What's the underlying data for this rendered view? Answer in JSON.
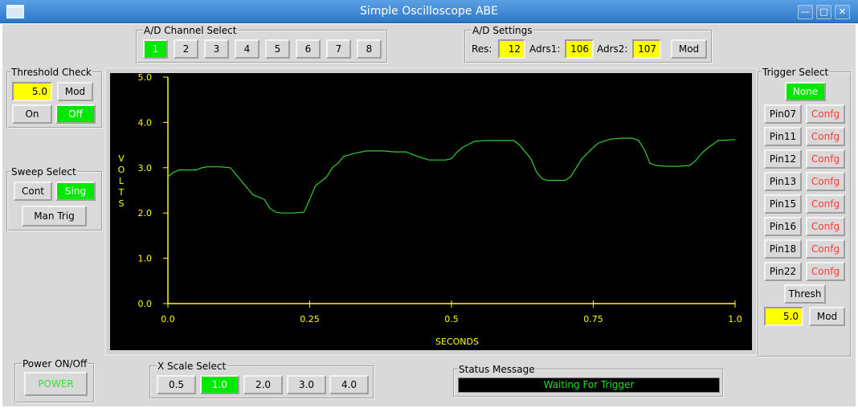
{
  "window": {
    "title": "Simple Oscilloscope ABE"
  },
  "channel_select": {
    "legend": "A/D Channel Select",
    "buttons": [
      "1",
      "2",
      "3",
      "4",
      "5",
      "6",
      "7",
      "8"
    ],
    "active": "1"
  },
  "ad_settings": {
    "legend": "A/D Settings",
    "res_label": "Res:",
    "res_value": "12",
    "adrs1_label": "Adrs1:",
    "adrs1_value": "106",
    "adrs2_label": "Adrs2:",
    "adrs2_value": "107",
    "mod_label": "Mod"
  },
  "threshold_check": {
    "legend": "Threshold Check",
    "value": "5.0",
    "mod_label": "Mod",
    "on_label": "On",
    "off_label": "Off",
    "active": "Off"
  },
  "sweep_select": {
    "legend": "Sweep Select",
    "cont_label": "Cont",
    "sing_label": "Sing",
    "active": "Sing",
    "man_trig_label": "Man Trig"
  },
  "trigger_select": {
    "legend": "Trigger Select",
    "none_label": "None",
    "pins": [
      "Pin07",
      "Pin11",
      "Pin12",
      "Pin13",
      "Pin15",
      "Pin16",
      "Pin18",
      "Pin22"
    ],
    "config_label": "Confg",
    "thresh_label": "Thresh",
    "value": "5.0",
    "mod_label": "Mod"
  },
  "power": {
    "legend": "Power ON/Off",
    "label": "POWER"
  },
  "x_scale": {
    "legend": "X Scale Select",
    "buttons": [
      "0.5",
      "1.0",
      "2.0",
      "3.0",
      "4.0"
    ],
    "active": "1.0"
  },
  "status": {
    "legend": "Status Message",
    "message": "Waiting For Trigger"
  },
  "colors": {
    "active_button": "#00e800",
    "value_field": "#ffff00",
    "axis": "#ffff00",
    "trace": "#2ed12e",
    "config_text": "#ff3a3a"
  },
  "chart_data": {
    "type": "line",
    "title": "",
    "xlabel": "SECONDS",
    "ylabel": "VOLTS",
    "xlim": [
      0,
      1.0
    ],
    "ylim": [
      0,
      5.0
    ],
    "x_ticks": [
      "0.0",
      "0.25",
      "0.5",
      "0.75",
      "1.0"
    ],
    "y_ticks": [
      "0.0",
      "1.0",
      "2.0",
      "3.0",
      "4.0",
      "5.0"
    ],
    "grid": false,
    "series": [
      {
        "x": [
          0.0,
          0.01,
          0.02,
          0.05,
          0.06,
          0.07,
          0.09,
          0.11,
          0.12,
          0.13,
          0.15,
          0.17,
          0.18,
          0.19,
          0.2,
          0.22,
          0.24,
          0.25,
          0.26,
          0.28,
          0.29,
          0.3,
          0.31,
          0.33,
          0.35,
          0.38,
          0.4,
          0.42,
          0.44,
          0.46,
          0.47,
          0.49,
          0.5,
          0.51,
          0.52,
          0.54,
          0.56,
          0.58,
          0.6,
          0.61,
          0.62,
          0.64,
          0.65,
          0.66,
          0.67,
          0.69,
          0.7,
          0.71,
          0.73,
          0.75,
          0.76,
          0.78,
          0.8,
          0.82,
          0.83,
          0.84,
          0.85,
          0.86,
          0.88,
          0.9,
          0.92,
          0.93,
          0.94,
          0.95,
          0.97,
          1.0
        ],
        "y": [
          2.8,
          2.9,
          2.95,
          2.95,
          3.0,
          3.02,
          3.02,
          3.0,
          2.85,
          2.7,
          2.4,
          2.3,
          2.1,
          2.02,
          2.0,
          2.0,
          2.02,
          2.3,
          2.6,
          2.8,
          3.0,
          3.1,
          3.25,
          3.32,
          3.37,
          3.37,
          3.35,
          3.35,
          3.25,
          3.17,
          3.17,
          3.17,
          3.2,
          3.35,
          3.45,
          3.58,
          3.6,
          3.6,
          3.6,
          3.6,
          3.5,
          3.2,
          2.9,
          2.75,
          2.72,
          2.72,
          2.72,
          2.8,
          3.2,
          3.45,
          3.55,
          3.63,
          3.65,
          3.65,
          3.6,
          3.4,
          3.1,
          3.05,
          3.03,
          3.03,
          3.05,
          3.15,
          3.3,
          3.42,
          3.6,
          3.62
        ]
      }
    ]
  }
}
